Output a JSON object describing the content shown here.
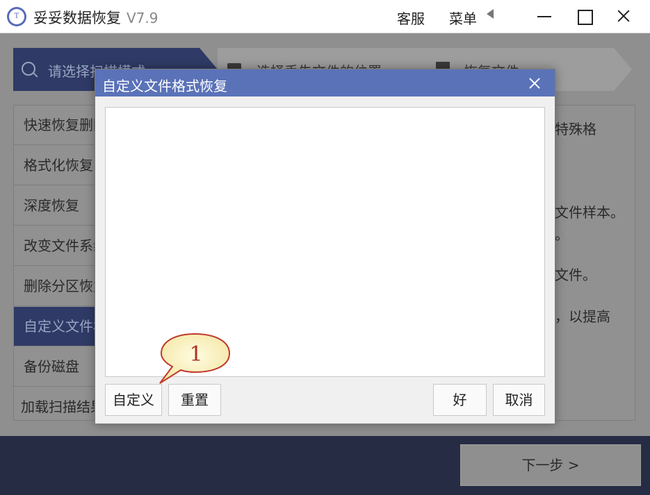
{
  "app": {
    "title": "妥妥数据恢复",
    "version": "V7.9",
    "logo_text": "T"
  },
  "titlebar": {
    "service_label": "客服",
    "menu_label": "菜单"
  },
  "steps": [
    {
      "label": "请选择扫描模式"
    },
    {
      "label": "选择丢失文件的位置"
    },
    {
      "label": "恢复文件"
    }
  ],
  "modes": [
    {
      "label": "快速恢复删除的文件"
    },
    {
      "label": "格式化恢复"
    },
    {
      "label": "深度恢复"
    },
    {
      "label": "改变文件系统恢复"
    },
    {
      "label": "删除分区恢复"
    },
    {
      "label": "自定义文件格式恢复"
    },
    {
      "label": "备份磁盘"
    },
    {
      "label": "加载扫描结果"
    }
  ],
  "description_fragments": [
    "特殊格",
    "文件样本。",
    "。",
    "文件。",
    "，以提高"
  ],
  "footer": {
    "next_label": "下一步 >"
  },
  "dialog": {
    "title": "自定义文件格式恢复",
    "buttons": {
      "custom": "自定义",
      "reset": "重置",
      "ok": "好",
      "cancel": "取消"
    }
  },
  "callout": {
    "number": "1"
  }
}
